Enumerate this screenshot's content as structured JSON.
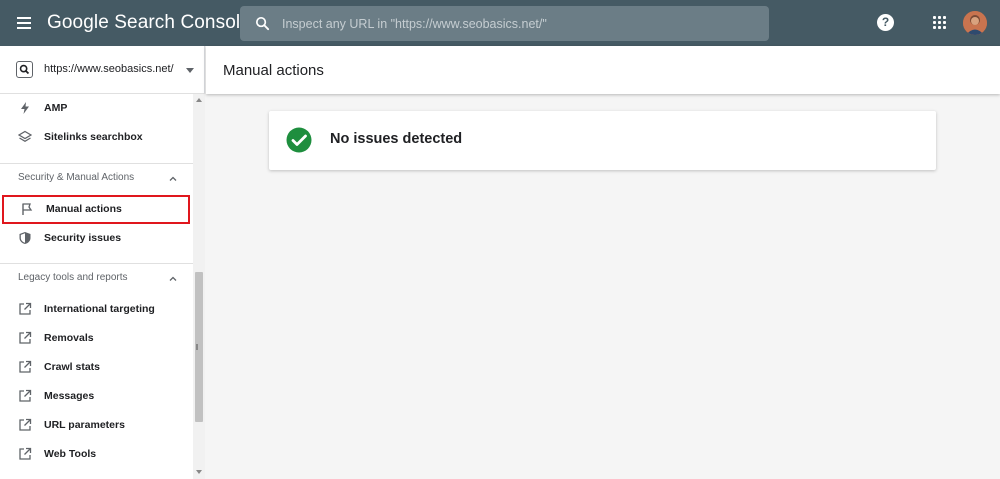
{
  "app": {
    "title_brand": "Google",
    "title_product": "Search Console"
  },
  "search": {
    "placeholder": "Inspect any URL in \"https://www.seobasics.net/\""
  },
  "property": {
    "url": "https://www.seobasics.net/"
  },
  "sidebar": {
    "items_top": [
      {
        "label": "AMP",
        "icon": "bolt-icon"
      },
      {
        "label": "Sitelinks searchbox",
        "icon": "layers-icon"
      }
    ],
    "section_security": {
      "title": "Security & Manual Actions",
      "items": [
        {
          "label": "Manual actions",
          "icon": "flag-icon"
        },
        {
          "label": "Security issues",
          "icon": "shield-icon"
        }
      ]
    },
    "section_legacy": {
      "title": "Legacy tools and reports",
      "items": [
        {
          "label": "International targeting",
          "icon": "external-link-icon"
        },
        {
          "label": "Removals",
          "icon": "external-link-icon"
        },
        {
          "label": "Crawl stats",
          "icon": "external-link-icon"
        },
        {
          "label": "Messages",
          "icon": "external-link-icon"
        },
        {
          "label": "URL parameters",
          "icon": "external-link-icon"
        },
        {
          "label": "Web Tools",
          "icon": "external-link-icon"
        }
      ]
    }
  },
  "main": {
    "page_title": "Manual actions",
    "status_message": "No issues detected"
  },
  "colors": {
    "topbar": "#455a64",
    "success": "#1e8e3e",
    "highlight_border": "#e0161d"
  }
}
